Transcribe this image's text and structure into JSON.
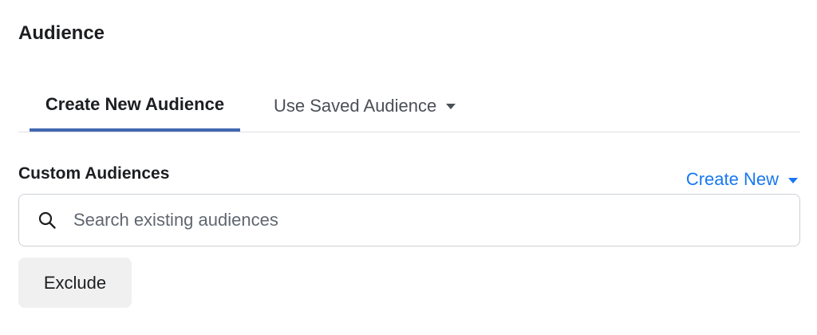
{
  "section": {
    "title": "Audience"
  },
  "tabs": [
    {
      "label": "Create New Audience",
      "active": true
    },
    {
      "label": "Use Saved Audience",
      "active": false,
      "icon": "caret-down-icon"
    }
  ],
  "custom_audiences": {
    "label": "Custom Audiences",
    "create_new_label": "Create New",
    "create_new_icon": "caret-down-icon",
    "search": {
      "placeholder": "Search existing audiences",
      "value": "",
      "icon": "search-icon"
    },
    "exclude_label": "Exclude"
  },
  "colors": {
    "accent": "#4267b2",
    "link": "#1877f2",
    "border": "#dddfe2",
    "button_bg": "#f0f0f0"
  }
}
